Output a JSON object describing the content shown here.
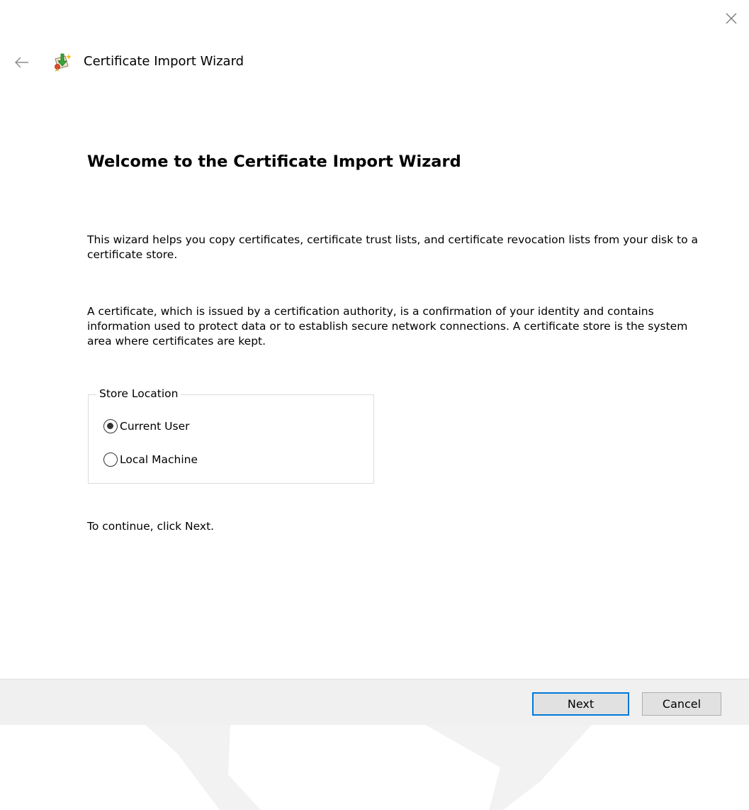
{
  "window": {
    "title": "Certificate Import Wizard",
    "close_icon": "close-icon",
    "back_icon": "back-arrow-icon",
    "app_icon": "certificate-wizard-icon"
  },
  "content": {
    "heading": "Welcome to the Certificate Import Wizard",
    "paragraph1": "This wizard helps you copy certificates, certificate trust lists, and certificate revocation lists from your disk to a certificate store.",
    "paragraph2": "A certificate, which is issued by a certification authority, is a confirmation of your identity and contains information used to protect data or to establish secure network connections. A certificate store is the system area where certificates are kept.",
    "store_location": {
      "legend": "Store Location",
      "options": [
        {
          "label": "Current User",
          "selected": true
        },
        {
          "label": "Local Machine",
          "selected": false
        }
      ]
    },
    "continue_text": "To continue, click Next."
  },
  "buttons": {
    "next_label": "Next",
    "cancel_label": "Cancel"
  },
  "colors": {
    "accent": "#0078d7",
    "button_bar": "#f0f0f0",
    "button_face": "#e1e1e1"
  }
}
